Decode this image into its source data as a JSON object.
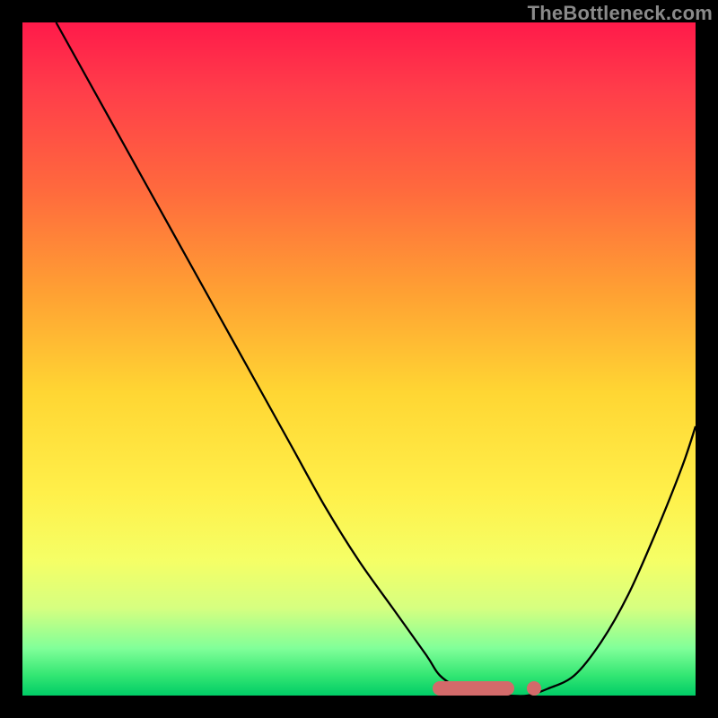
{
  "watermark": "TheBottleneck.com",
  "chart_data": {
    "type": "line",
    "title": "",
    "xlabel": "",
    "ylabel": "",
    "xlim": [
      0,
      100
    ],
    "ylim": [
      0,
      100
    ],
    "grid": false,
    "series": [
      {
        "name": "bottleneck-curve",
        "x": [
          5,
          10,
          15,
          20,
          25,
          30,
          35,
          40,
          45,
          50,
          55,
          60,
          62,
          65,
          68,
          72,
          75,
          78,
          82,
          86,
          90,
          94,
          98,
          100
        ],
        "values": [
          100,
          91,
          82,
          73,
          64,
          55,
          46,
          37,
          28,
          20,
          13,
          6,
          3,
          1,
          0,
          0,
          0,
          1,
          3,
          8,
          15,
          24,
          34,
          40
        ]
      }
    ],
    "highlight": {
      "name": "optimal-flat-region",
      "x_start_pct": 62,
      "x_end_pct": 72,
      "y_pct": 0,
      "marker_x_pct": 76
    },
    "colors": {
      "curve": "#000000",
      "highlight": "#d36a6a",
      "gradient_top": "#ff1a4a",
      "gradient_bottom": "#00cc66"
    }
  }
}
